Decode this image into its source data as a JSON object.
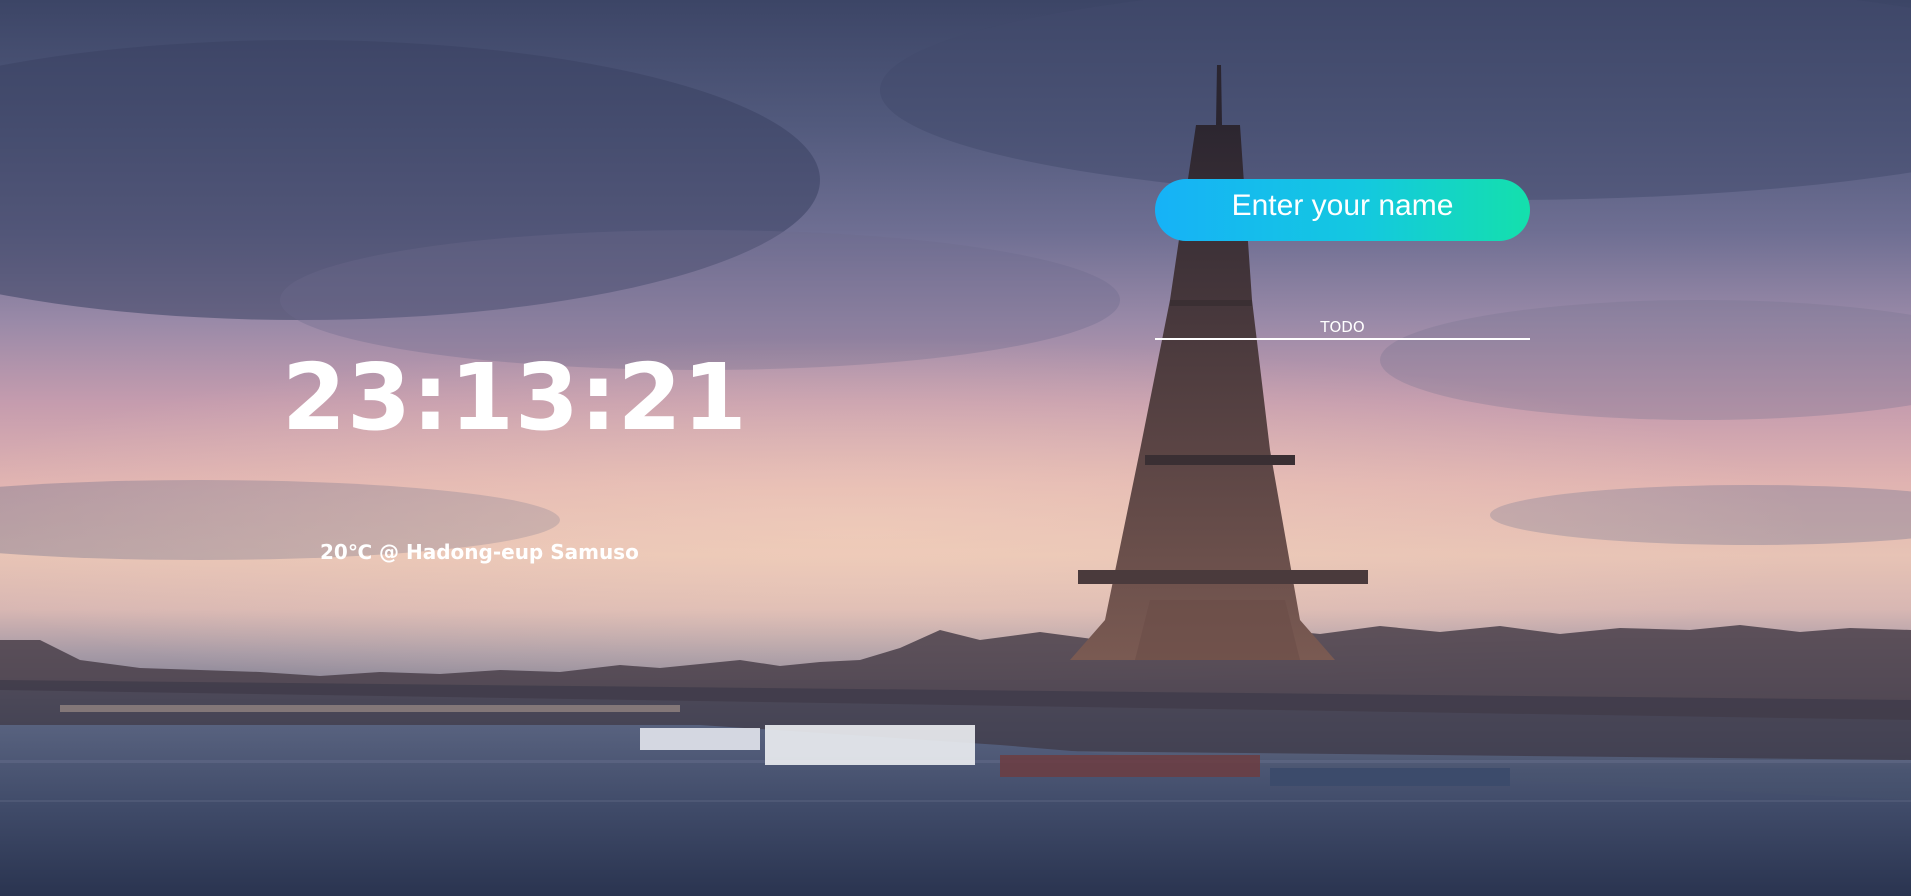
{
  "clock": {
    "time": "23:13:21"
  },
  "weather": {
    "text": "20℃ @ Hadong-eup Samuso"
  },
  "greeting_form": {
    "placeholder": "Enter your name"
  },
  "todo_form": {
    "placeholder": "TODO"
  },
  "background": {
    "scene": "eiffel-tower-seine-dusk"
  },
  "colors": {
    "input_gradient_start": "#16b2f7",
    "input_gradient_end": "#14e0ac",
    "text": "#ffffff"
  }
}
